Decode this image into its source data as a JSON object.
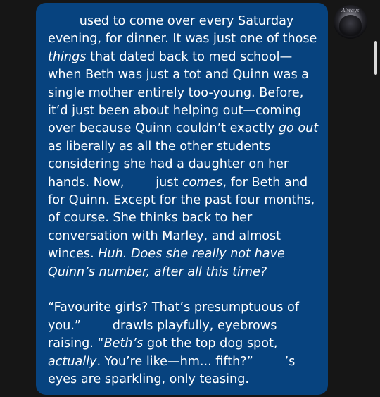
{
  "message": {
    "paragraph1": [
      {
        "t": "        used to come over every Saturday evening, for dinner. It was just one of those "
      },
      {
        "t": "things",
        "i": true
      },
      {
        "t": " that dated back to med school—when Beth was just a tot and Quinn was a single mother entirely too-young. Before, it’d just been about helping out—coming over because Quinn couldn’t exactly "
      },
      {
        "t": "go out",
        "i": true
      },
      {
        "t": " as liberally as all the other students considering she had a daughter on her hands. Now,        just "
      },
      {
        "t": "comes",
        "i": true
      },
      {
        "t": ", for Beth and for Quinn. Except for the past four months, of course. She thinks back to her conversation with Marley, and almost winces. "
      },
      {
        "t": "Huh. Does she really not have Quinn’s number, after all this time?",
        "i": true
      }
    ],
    "paragraph2": [
      {
        "t": "“Favourite girls? That’s presumptuous of you.”        drawls playfully, eyebrows raising. “"
      },
      {
        "t": "Beth’s",
        "i": true
      },
      {
        "t": " got the top dog spot, "
      },
      {
        "t": "actually",
        "i": true
      },
      {
        "t": ". You’re like—hm... fifth?”        ’s eyes are sparkling, only teasing."
      }
    ]
  },
  "avatar": {
    "caption": "Always"
  },
  "colors": {
    "bubble": "#07437f",
    "background": "#161616",
    "text": "#ffffff"
  }
}
